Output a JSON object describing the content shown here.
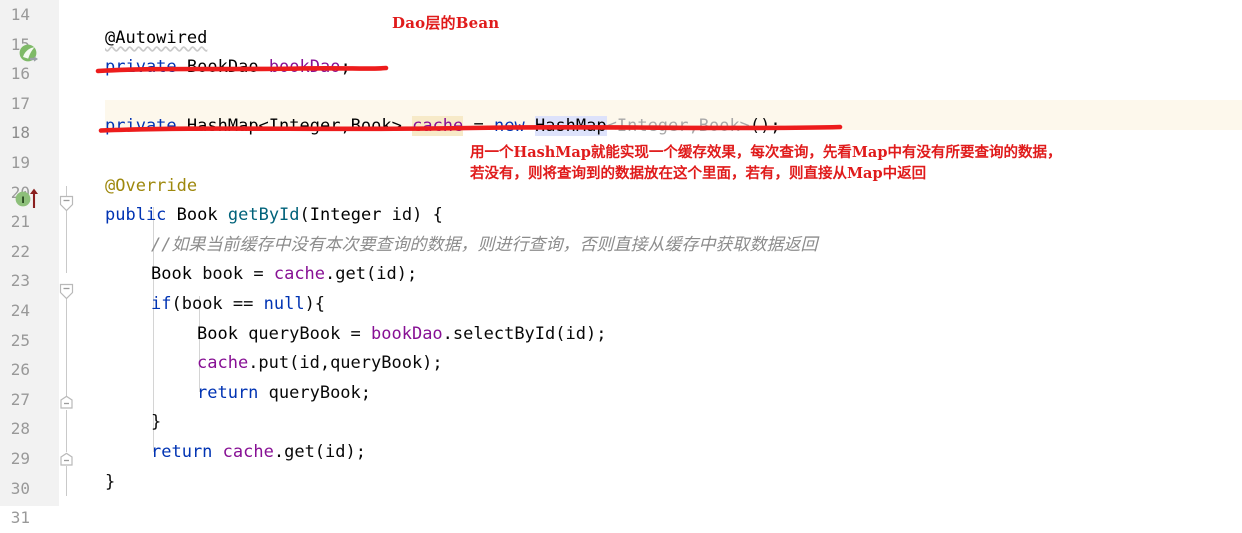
{
  "editor": {
    "app": "intellij-idea-java-editor",
    "first_line_number": 14,
    "current_line_number": 18,
    "colors": {
      "background": "#ffffff",
      "gutter": "#f2f2f2",
      "line_number": "#999999",
      "keyword": "#0033b3",
      "field": "#871094",
      "annotation": "#9e880d",
      "comment": "#8c8c8c",
      "method": "#00627a",
      "grayed_type": "#a8a8a8",
      "identifier_highlight": "#f7eac8",
      "new_highlight": "#dde2fb",
      "current_line": "#fdf8ec",
      "red_annotation": "#e01b1b"
    },
    "line_numbers": [
      "14",
      "15",
      "16",
      "17",
      "18",
      "19",
      "20",
      "21",
      "22",
      "23",
      "24",
      "25",
      "26",
      "27",
      "28",
      "29",
      "30",
      "31"
    ],
    "gutter_icons": [
      {
        "name": "spring-bean-icon",
        "line": 16,
        "tooltip_semantic": "autowired-bean-navigation"
      },
      {
        "name": "implementing-method-icon",
        "line": 21,
        "tooltip_semantic": "implements-method-in-interface"
      }
    ],
    "fold_markers": [
      {
        "name": "fold-marker-method",
        "line": 21
      },
      {
        "name": "fold-marker-if",
        "line": 24
      },
      {
        "name": "fold-marker-block-28",
        "line": 28
      },
      {
        "name": "fold-marker-block-30",
        "line": 30
      }
    ],
    "lines": [
      {
        "n": 15,
        "indent": 0,
        "tokens": [
          {
            "t": "@Autowired",
            "c": "anno-wave"
          }
        ]
      },
      {
        "n": 16,
        "indent": 0,
        "tokens": [
          {
            "t": "private",
            "c": "kw"
          },
          {
            "t": " ",
            "c": "plain"
          },
          {
            "t": "BookDao",
            "c": "type"
          },
          {
            "t": " ",
            "c": "plain"
          },
          {
            "t": "bookDao",
            "c": "field"
          },
          {
            "t": ";",
            "c": "plain"
          }
        ]
      },
      {
        "n": 18,
        "indent": 0,
        "tokens": [
          {
            "t": "private",
            "c": "kw"
          },
          {
            "t": " ",
            "c": "plain"
          },
          {
            "t": "HashMap<Integer,Book>",
            "c": "type"
          },
          {
            "t": " ",
            "c": "plain"
          },
          {
            "t": "cache",
            "c": "hl-cache"
          },
          {
            "t": " = ",
            "c": "plain"
          },
          {
            "t": "new",
            "c": "kw"
          },
          {
            "t": " ",
            "c": "plain"
          },
          {
            "t": "HashMap",
            "c": "hl-new"
          },
          {
            "t": "<Integer,Book>",
            "c": "grayed"
          },
          {
            "t": "();",
            "c": "plain"
          }
        ]
      },
      {
        "n": 20,
        "indent": 0,
        "tokens": [
          {
            "t": "@Override",
            "c": "anno"
          }
        ]
      },
      {
        "n": 21,
        "indent": 0,
        "tokens": [
          {
            "t": "public",
            "c": "kw"
          },
          {
            "t": " ",
            "c": "plain"
          },
          {
            "t": "Book",
            "c": "type"
          },
          {
            "t": " ",
            "c": "plain"
          },
          {
            "t": "getById",
            "c": "method"
          },
          {
            "t": "(",
            "c": "plain"
          },
          {
            "t": "Integer",
            "c": "type"
          },
          {
            "t": " id) {",
            "c": "plain"
          }
        ]
      },
      {
        "n": 22,
        "indent": 1,
        "tokens": [
          {
            "t": "//如果当前缓存中没有本次要查询的数据，则进行查询，否则直接从缓存中获取数据返回",
            "c": "comment"
          }
        ]
      },
      {
        "n": 23,
        "indent": 1,
        "tokens": [
          {
            "t": "Book",
            "c": "type"
          },
          {
            "t": " book = ",
            "c": "plain"
          },
          {
            "t": "cache",
            "c": "field"
          },
          {
            "t": ".",
            "c": "plain"
          },
          {
            "t": "get",
            "c": "plain"
          },
          {
            "t": "(id);",
            "c": "plain"
          }
        ]
      },
      {
        "n": 24,
        "indent": 1,
        "tokens": [
          {
            "t": "if",
            "c": "kw"
          },
          {
            "t": "(book == ",
            "c": "plain"
          },
          {
            "t": "null",
            "c": "kw"
          },
          {
            "t": "){",
            "c": "plain"
          }
        ]
      },
      {
        "n": 25,
        "indent": 2,
        "tokens": [
          {
            "t": "Book",
            "c": "type"
          },
          {
            "t": " queryBook = ",
            "c": "plain"
          },
          {
            "t": "bookDao",
            "c": "field"
          },
          {
            "t": ".selectById(id);",
            "c": "plain"
          }
        ]
      },
      {
        "n": 26,
        "indent": 2,
        "tokens": [
          {
            "t": "cache",
            "c": "field"
          },
          {
            "t": ".put(id,queryBook);",
            "c": "plain"
          }
        ]
      },
      {
        "n": 27,
        "indent": 2,
        "tokens": [
          {
            "t": "return",
            "c": "kw"
          },
          {
            "t": " queryBook;",
            "c": "plain"
          }
        ]
      },
      {
        "n": 28,
        "indent": 1,
        "tokens": [
          {
            "t": "}",
            "c": "plain"
          }
        ]
      },
      {
        "n": 29,
        "indent": 1,
        "tokens": [
          {
            "t": "return",
            "c": "kw"
          },
          {
            "t": " ",
            "c": "plain"
          },
          {
            "t": "cache",
            "c": "field"
          },
          {
            "t": ".get(id);",
            "c": "plain"
          }
        ]
      },
      {
        "n": 30,
        "indent": 0,
        "tokens": [
          {
            "t": "}",
            "c": "plain"
          }
        ]
      }
    ]
  },
  "annotations": {
    "bean_label": "Dao层的Bean",
    "note_line1": "用一个HashMap就能实现一个缓存效果，每次查询，先看Map中有没有所要查询的数据，",
    "note_line2": "若没有，则将查询到的数据放在这个里面，若有，则直接从Map中返回",
    "underlines": [
      {
        "name": "red-underline-bookdao-field",
        "line": 16
      },
      {
        "name": "red-underline-hashmap-cache-field",
        "line": 18
      }
    ]
  }
}
